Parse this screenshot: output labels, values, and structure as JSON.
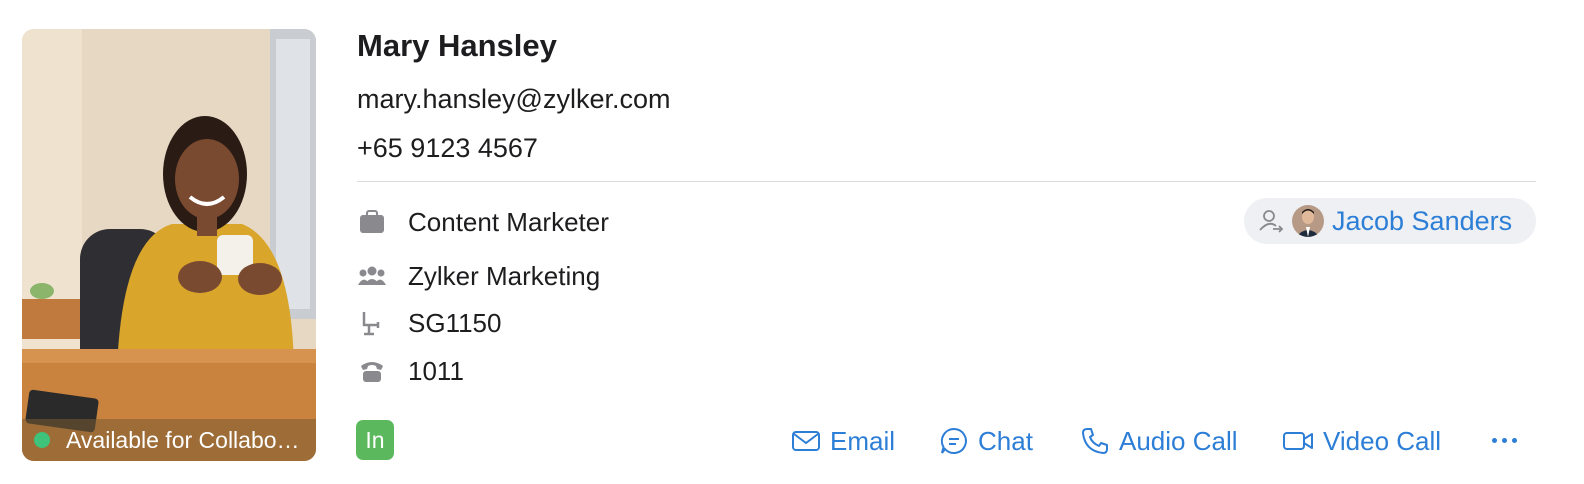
{
  "profile": {
    "name": "Mary Hansley",
    "email": "mary.hansley@zylker.com",
    "phone": "+65 9123 4567",
    "status_text": "Available for Collaboration",
    "status_color": "#3fc27a"
  },
  "details": [
    {
      "icon": "briefcase-icon",
      "label": "Content Marketer"
    },
    {
      "icon": "team-icon",
      "label": "Zylker Marketing"
    },
    {
      "icon": "seat-icon",
      "label": "SG1150"
    },
    {
      "icon": "desk-phone-icon",
      "label": "1011"
    }
  ],
  "reporting_manager": {
    "icon": "reports-to-icon",
    "name": "Jacob Sanders"
  },
  "social": {
    "linkedin_label": "In",
    "color": "#5cb85c"
  },
  "actions": {
    "email": "Email",
    "chat": "Chat",
    "audio_call": "Audio Call",
    "video_call": "Video Call"
  },
  "theme": {
    "accent": "#2d7ed6",
    "divider": "#dcdcdc"
  }
}
